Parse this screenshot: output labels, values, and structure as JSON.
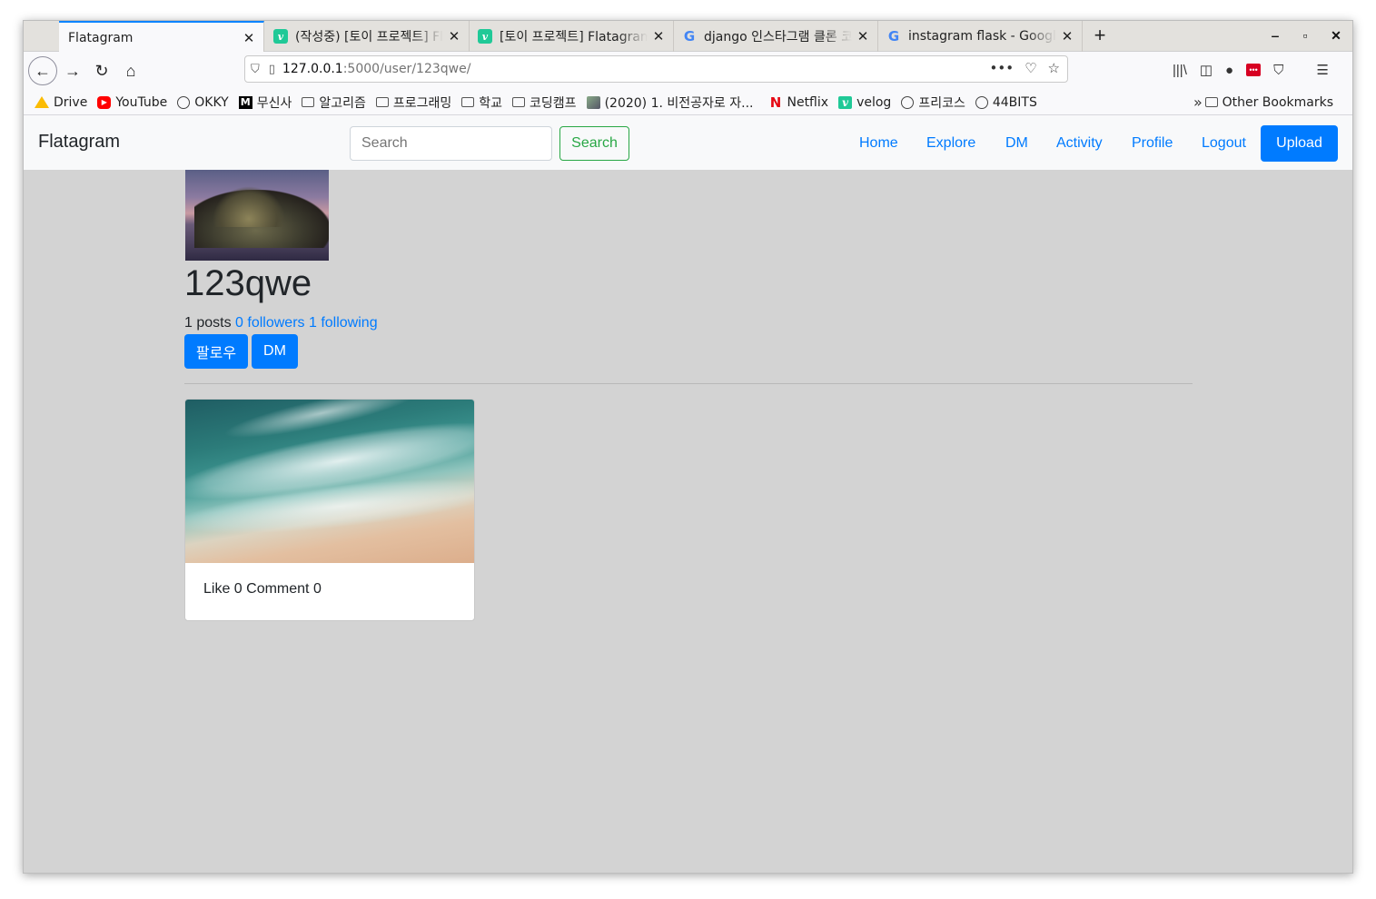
{
  "browser": {
    "tabs": [
      {
        "title": "Flatagram",
        "favicon": "none"
      },
      {
        "title": "(작성중) [토이 프로젝트] Fl",
        "favicon": "velog-icon"
      },
      {
        "title": "[토이 프로젝트] Flatagram",
        "favicon": "velog-icon"
      },
      {
        "title": "django 인스타그램 클론 코",
        "favicon": "google-icon"
      },
      {
        "title": "instagram flask - Google",
        "favicon": "google-icon"
      }
    ],
    "new_tab": "+",
    "url_host": "127.0.0.1",
    "url_path": ":5000/user/123qwe/",
    "bookmarks": [
      {
        "label": "Drive",
        "icon": "drive-icon"
      },
      {
        "label": "YouTube",
        "icon": "youtube-icon"
      },
      {
        "label": "OKKY",
        "icon": "globe-icon"
      },
      {
        "label": "무신사",
        "icon": "musinsa-icon"
      },
      {
        "label": "알고리즘",
        "icon": "folder-icon"
      },
      {
        "label": "프로그래밍",
        "icon": "folder-icon"
      },
      {
        "label": "학교",
        "icon": "folder-icon"
      },
      {
        "label": "코딩캠프",
        "icon": "folder-icon"
      },
      {
        "label": "(2020) 1. 비전공자로 자...",
        "icon": "image-icon"
      },
      {
        "label": "Netflix",
        "icon": "netflix-icon"
      },
      {
        "label": "velog",
        "icon": "velog-icon"
      },
      {
        "label": "프리코스",
        "icon": "globe-icon"
      },
      {
        "label": "44BITS",
        "icon": "globe-icon"
      }
    ],
    "other_bookmarks": "Other Bookmarks"
  },
  "site": {
    "brand": "Flatagram",
    "search_placeholder": "Search",
    "search_button": "Search",
    "nav": [
      "Home",
      "Explore",
      "DM",
      "Activity",
      "Profile",
      "Logout"
    ],
    "upload": "Upload"
  },
  "profile": {
    "username": "123qwe",
    "posts": "1 posts",
    "followers": "0 followers",
    "following": "1 following",
    "follow_button": "팔로우",
    "dm_button": "DM"
  },
  "posts": [
    {
      "likes_comments": "Like 0 Comment 0"
    }
  ],
  "colors": {
    "primary": "#007bff",
    "success": "#28a745",
    "page_bg": "#d3d3d3",
    "nav_bg": "#f8f9fa"
  }
}
